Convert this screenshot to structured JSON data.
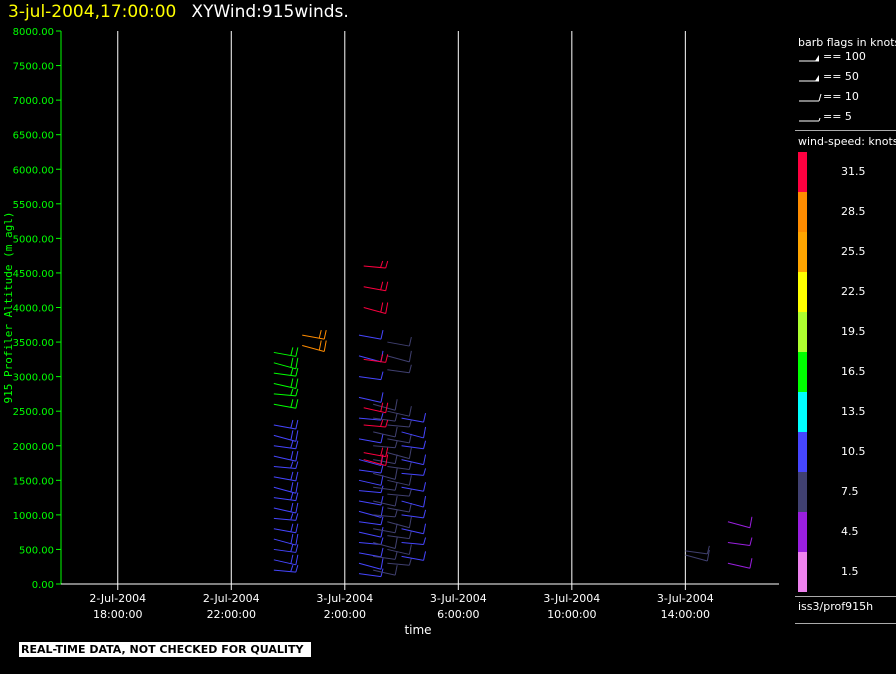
{
  "title": {
    "timestamp": "3-jul-2004,17:00:00",
    "main": "XYWind:915winds."
  },
  "legend": {
    "barb_title": "barb flags in knots",
    "barbs": [
      {
        "label": "== 100",
        "kind": "pennant2"
      },
      {
        "label": "== 50",
        "kind": "pennant"
      },
      {
        "label": "== 10",
        "kind": "full"
      },
      {
        "label": "== 5",
        "kind": "half"
      }
    ],
    "ws_title": "wind-speed: knots",
    "source": "iss3/prof915h"
  },
  "qc_banner": "REAL-TIME DATA, NOT CHECKED FOR QUALITY",
  "colors": {
    "axis": "#00ff00",
    "grid": "#ffffff",
    "background": "#000000",
    "scale": [
      "#ee82ee",
      "#9a1fe0",
      "#404070",
      "#4646ff",
      "#00ffff",
      "#00ff00",
      "#adff2f",
      "#ffff00",
      "#ffa500",
      "#ff8c00",
      "#ff0040"
    ]
  },
  "chart_data": {
    "type": "wind-barb time-height",
    "xlabel": "time",
    "ylabel": "915 Profiler Altitude (m agl)",
    "ylim": [
      0,
      8000
    ],
    "yticks": [
      "0.00",
      "500.00",
      "1000.00",
      "1500.00",
      "2000.00",
      "2500.00",
      "3000.00",
      "3500.00",
      "4000.00",
      "4500.00",
      "5000.00",
      "5500.00",
      "6000.00",
      "6500.00",
      "7000.00",
      "7500.00",
      "8000.00"
    ],
    "xlim_hours_from_2jul_1600": [
      0,
      25.3
    ],
    "xticks": [
      {
        "line1": "2-Jul-2004",
        "line2": "18:00:00"
      },
      {
        "line1": "2-Jul-2004",
        "line2": "22:00:00"
      },
      {
        "line1": "3-Jul-2004",
        "line2": "2:00:00"
      },
      {
        "line1": "3-Jul-2004",
        "line2": "6:00:00"
      },
      {
        "line1": "3-Jul-2004",
        "line2": "10:00:00"
      },
      {
        "line1": "3-Jul-2004",
        "line2": "14:00:00"
      }
    ],
    "colorbar": {
      "labels": [
        "1.5",
        "4.5",
        "7.5",
        "10.5",
        "13.5",
        "16.5",
        "19.5",
        "22.5",
        "25.5",
        "28.5",
        "31.5"
      ]
    },
    "series": [
      {
        "time": "2-Jul 23:30",
        "heights": [
          200,
          350,
          500,
          650,
          800,
          950,
          1100,
          1250,
          1400,
          1550,
          1700,
          1850,
          2000,
          2150,
          2300
        ],
        "speed": 10.5
      },
      {
        "time": "2-Jul 23:30",
        "heights": [
          2600,
          2750,
          2900,
          3050,
          3200,
          3350
        ],
        "speed": 17
      },
      {
        "time": "3-Jul 00:30",
        "heights": [
          3450,
          3600
        ],
        "speed": 27
      },
      {
        "time": "3-Jul 02:30",
        "heights": [
          150,
          300,
          450,
          600,
          750,
          900,
          1050,
          1200,
          1350,
          1500,
          1650,
          1800,
          2100,
          2400,
          2700,
          3000,
          3300,
          3600
        ],
        "speed": 9
      },
      {
        "time": "3-Jul 03:00",
        "heights": [
          200,
          400,
          600,
          800,
          1000,
          1200,
          1400,
          1600,
          1800,
          2000,
          2200,
          2400,
          2600
        ],
        "speed": 8
      },
      {
        "time": "3-Jul 03:30",
        "heights": [
          300,
          500,
          700,
          900,
          1100,
          1300,
          1500,
          1700,
          1900,
          2100,
          2300,
          2500,
          3100,
          3300,
          3500
        ],
        "speed": 8
      },
      {
        "time": "3-Jul 04:00",
        "heights": [
          400,
          600,
          800,
          1000,
          1200,
          1400,
          1600,
          1800,
          2000,
          2200,
          2400
        ],
        "speed": 9
      },
      {
        "time": "3-Jul 02:40",
        "heights": [
          1800,
          1900,
          2300,
          2550,
          3250,
          4000,
          4300,
          4600
        ],
        "speed": 31
      },
      {
        "time": "3-Jul 14:00",
        "heights": [
          480,
          420
        ],
        "speed": 6
      },
      {
        "time": "3-Jul 15:30",
        "heights": [
          300,
          600,
          900
        ],
        "speed": 5
      }
    ]
  }
}
